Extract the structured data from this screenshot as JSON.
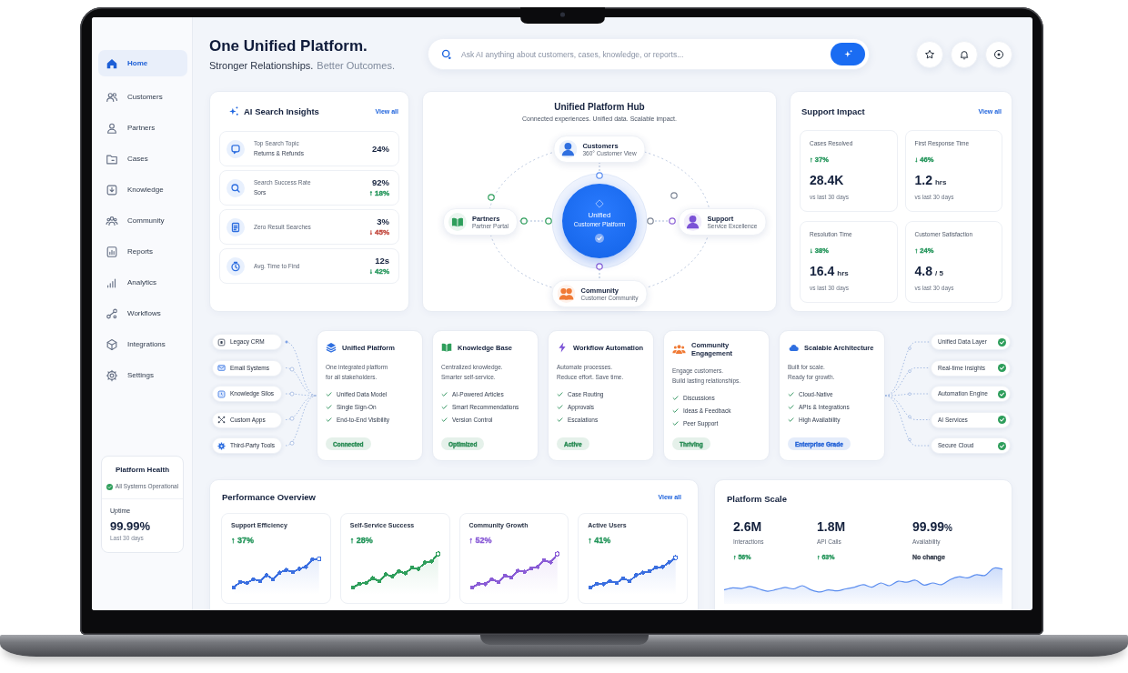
{
  "sidebar": {
    "items": [
      {
        "label": "Home",
        "selected": true
      },
      {
        "label": "Customers",
        "selected": false
      },
      {
        "label": "Partners",
        "selected": false
      },
      {
        "label": "Cases",
        "selected": false
      },
      {
        "label": "Knowledge",
        "selected": false
      },
      {
        "label": "Community",
        "selected": false
      },
      {
        "label": "Reports",
        "selected": false
      },
      {
        "label": "Analytics",
        "selected": false
      },
      {
        "label": "Workflows",
        "selected": false
      },
      {
        "label": "Integrations",
        "selected": false
      },
      {
        "label": "Settings",
        "selected": false
      }
    ],
    "platform_health": {
      "title": "Platform Health",
      "status": "All Systems Operational",
      "uptime_label": "Uptime",
      "uptime": "99.99%",
      "period": "Last 30 days"
    }
  },
  "header": {
    "title": "One Unified Platform.",
    "subtitle": "Stronger Relationships.",
    "subtitle_muted": "Better Outcomes."
  },
  "search": {
    "placeholder": "Ask AI anything about customers, cases, knowledge, or reports..."
  },
  "ai_search_insights": {
    "title": "AI Search Insights",
    "link": "View all",
    "rows": [
      {
        "label": "Top Search Topic",
        "detail": "Returns & Refunds",
        "value": "24%"
      },
      {
        "label": "Search Success Rate",
        "detail": "Sors",
        "value": "92%",
        "change": {
          "text": "↑ 18%",
          "color": "#23955a"
        }
      },
      {
        "label": "Zero Result Searches",
        "value": "3%",
        "change": {
          "text": "↓ 45%",
          "color": "#c2473d"
        }
      },
      {
        "label": "Avg. Time to Find",
        "value": "12s",
        "change": {
          "text": "↓ 42%",
          "color": "#23955a"
        }
      }
    ]
  },
  "hub": {
    "title": "Unified Platform Hub",
    "subtitle": "Connected experiences. Unified data. Scalable impact.",
    "center": {
      "title": "Unified",
      "subtitle": "Customer Platform"
    },
    "nodes": [
      {
        "title": "Customers",
        "subtitle": "360° Customer View",
        "color": "#2f6fe0"
      },
      {
        "title": "Partners",
        "subtitle": "Partner Portal",
        "color": "#2e9e5b"
      },
      {
        "title": "Support",
        "subtitle": "Service Excellence",
        "color": "#7b52d6"
      },
      {
        "title": "Community",
        "subtitle": "Customer Community",
        "color": "#f07a35"
      }
    ]
  },
  "support_impact": {
    "title": "Support Impact",
    "link": "View all",
    "metrics": [
      {
        "label": "Cases Resolved",
        "change": {
          "text": "↑ 37%",
          "color": "#23955a"
        },
        "value": "28.4K",
        "note": "vs last 30 days"
      },
      {
        "label": "First Response Time",
        "change": {
          "text": "↓ 46%",
          "color": "#23955a"
        },
        "value": "1.2",
        "unit": "hrs",
        "note": "vs last 30 days"
      },
      {
        "label": "Resolution Time",
        "change": {
          "text": "↓ 38%",
          "color": "#23955a"
        },
        "value": "16.4",
        "unit": "hrs",
        "note": "vs last 30 days"
      },
      {
        "label": "Customer Satisfaction",
        "change": {
          "text": "↑ 24%",
          "color": "#23955a"
        },
        "value": "4.8",
        "unit": "/ 5",
        "note": "vs last 30 days"
      }
    ]
  },
  "integration": {
    "sources": [
      "Legacy CRM",
      "Email Systems",
      "Knowledge Silos",
      "Custom Apps",
      "Third-Party Tools"
    ],
    "capabilities": [
      {
        "title": "Unified Platform",
        "color": "#2f6fe0",
        "description": "One integrated platform\nfor all stakeholders.",
        "features": [
          "Unified Data Model",
          "Single Sign-On",
          "End-to-End Visibility"
        ],
        "badge": {
          "label": "Connected",
          "color": "#23884f"
        }
      },
      {
        "title": "Knowledge Base",
        "color": "#2e9e5b",
        "description": "Centralized knowledge.\nSmarter self-service.",
        "features": [
          "AI-Powered Articles",
          "Smart Recommendations",
          "Version Control"
        ],
        "badge": {
          "label": "Optimized",
          "color": "#23884f"
        }
      },
      {
        "title": "Workflow Automation",
        "color": "#7b52d6",
        "description": "Automate processes.\nReduce effort. Save time.",
        "features": [
          "Case Routing",
          "Approvals",
          "Escalations"
        ],
        "badge": {
          "label": "Active",
          "color": "#23884f"
        }
      },
      {
        "title": "Community Engagement",
        "color": "#f07a35",
        "description": "Engage customers.\nBuild lasting relationships.",
        "features": [
          "Discussions",
          "Ideas & Feedback",
          "Peer Support"
        ],
        "badge": {
          "label": "Thriving",
          "color": "#23884f"
        }
      },
      {
        "title": "Scalable Architecture",
        "color": "#2f6fe0",
        "description": "Built for scale.\nReady for growth.",
        "features": [
          "Cloud-Native",
          "APIs & Integrations",
          "High Availability"
        ],
        "badge": {
          "label": "Enterprise Grade",
          "color": "#1f5fd6"
        }
      }
    ],
    "outputs": [
      {
        "label": "Unified Data Layer",
        "checked": true
      },
      {
        "label": "Real-time Insights",
        "checked": true
      },
      {
        "label": "Automation Engine",
        "checked": true
      },
      {
        "label": "AI Services",
        "checked": true
      },
      {
        "label": "Secure Cloud",
        "checked": true
      }
    ]
  },
  "performance_overview": {
    "title": "Performance Overview",
    "link": "View all",
    "cards": [
      {
        "label": "Support Efficiency",
        "change": {
          "text": "↑ 37%",
          "color": "#23955a"
        },
        "color": "#3b6fe0"
      },
      {
        "label": "Self-Service Success",
        "change": {
          "text": "↑ 28%",
          "color": "#23955a"
        },
        "color": "#2e9e5b"
      },
      {
        "label": "Community Growth",
        "change": {
          "text": "↑ 52%",
          "color": "#8a5cd6"
        },
        "color": "#8a5cd6"
      },
      {
        "label": "Active Users",
        "change": {
          "text": "↑ 41%",
          "color": "#23955a"
        },
        "color": "#3b6fe0"
      }
    ]
  },
  "platform_scale": {
    "title": "Platform Scale",
    "stats": [
      {
        "value": "2.6M",
        "label": "Interactions",
        "change": {
          "text": "↑ 56%",
          "color": "#23955a"
        }
      },
      {
        "value": "1.8M",
        "label": "API Calls",
        "change": {
          "text": "↑ 63%",
          "color": "#23955a"
        }
      },
      {
        "value": "99.99",
        "unit": "%",
        "label": "Availability",
        "change": {
          "text": "No change",
          "color": "#3f4654"
        }
      }
    ]
  }
}
